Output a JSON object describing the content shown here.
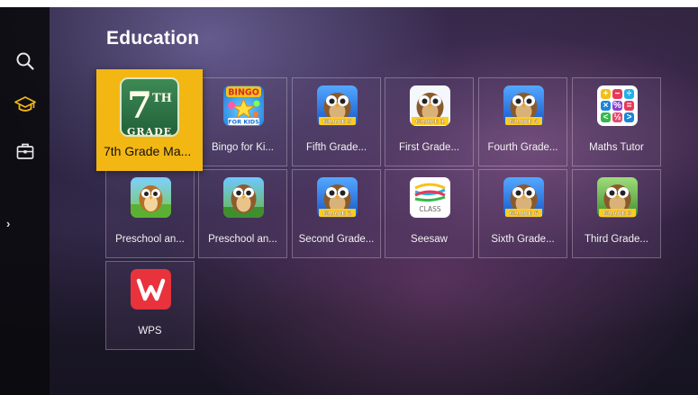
{
  "page": {
    "title": "Education"
  },
  "sidebar": {
    "items": [
      {
        "name": "search",
        "icon": "search-icon",
        "active": false
      },
      {
        "name": "education",
        "icon": "graduation-cap-icon",
        "active": true
      },
      {
        "name": "tools",
        "icon": "toolbox-icon",
        "active": false
      }
    ],
    "expand_glyph": "›",
    "accent": "#f3b713"
  },
  "apps": [
    {
      "label": "7th Grade Ma...",
      "icon": "seventh-grade-icon",
      "grade_num": "7",
      "grade_sup": "TH",
      "grade_text": "GRADE",
      "focused": true
    },
    {
      "label": "Bingo for Ki...",
      "icon": "bingo-icon",
      "icon_text_top": "BINGO",
      "icon_text_bottom": "FOR KIDS"
    },
    {
      "label": "Fifth Grade...",
      "icon": "owl-icon",
      "badge": "GRADE 5"
    },
    {
      "label": "First Grade...",
      "icon": "owl-icon",
      "badge": "GRADE 1"
    },
    {
      "label": "Fourth Grade...",
      "icon": "owl-icon",
      "badge": "GRADE 4"
    },
    {
      "label": "Maths Tutor",
      "icon": "maths-tutor-icon",
      "symbols": [
        "+",
        "−",
        "÷",
        "×",
        "%",
        "=",
        "<",
        "½",
        ">"
      ]
    },
    {
      "label": "Preschool an...",
      "icon": "preschool-owl-icon"
    },
    {
      "label": "Preschool an...",
      "icon": "preschool-owl-icon"
    },
    {
      "label": "Second Grade...",
      "icon": "owl-icon",
      "badge": "GRADE 2"
    },
    {
      "label": "Seesaw",
      "icon": "seesaw-icon",
      "icon_text": "CLASS"
    },
    {
      "label": "Sixth Grade...",
      "icon": "owl-icon",
      "badge": "GRADE 6"
    },
    {
      "label": "Third Grade...",
      "icon": "owl-icon",
      "badge": "GRADE 3"
    },
    {
      "label": "WPS",
      "icon": "wps-icon"
    }
  ]
}
